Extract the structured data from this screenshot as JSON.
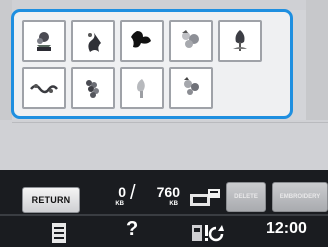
{
  "patterns": [
    {
      "icon": "rose-pattern-icon"
    },
    {
      "icon": "leaf-spray-pattern-icon"
    },
    {
      "icon": "black-flower-pattern-icon"
    },
    {
      "icon": "bouquet-pattern-icon"
    },
    {
      "icon": "tulip-pattern-icon"
    },
    {
      "icon": "vine-border-pattern-icon"
    },
    {
      "icon": "grape-cluster-pattern-icon"
    },
    {
      "icon": "pale-flower-pattern-icon"
    },
    {
      "icon": "small-bouquet-pattern-icon"
    }
  ],
  "buttons": {
    "return_label": "RETURN",
    "delete_label": "DELETE",
    "embroidery_label": "EMBROIDERY"
  },
  "memory": {
    "used": "0",
    "used_unit": "KB",
    "total": "760",
    "total_unit": "KB"
  },
  "clock": "12:00",
  "colors": {
    "panel_border": "#1f8fe0",
    "bar_background": "#1a1c20",
    "disabled_button": "#b8babd"
  }
}
